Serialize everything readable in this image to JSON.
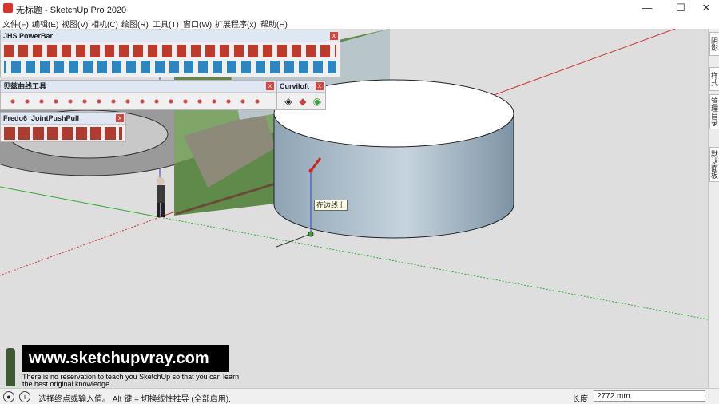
{
  "window": {
    "title": "无标题 - SketchUp Pro 2020",
    "min": "—",
    "max": "☐",
    "close": "✕"
  },
  "menu": [
    "文件(F)",
    "编辑(E)",
    "视图(V)",
    "相机(C)",
    "绘图(R)",
    "工具(T)",
    "窗口(W)",
    "扩展程序(x)",
    "帮助(H)"
  ],
  "palettes": {
    "powerbar": {
      "title": "JHS PowerBar"
    },
    "bezier": {
      "title": "贝兹曲线工具"
    },
    "curviloft": {
      "title": "Curviloft"
    },
    "fredo": {
      "title": "Fredo6_JointPushPull"
    },
    "close_label": "x"
  },
  "viewport": {
    "tooltip": "在边线上"
  },
  "watermark": {
    "url": "www.sketchupvray.com",
    "line1": "There is no reservation to teach you SketchUp so that you can learn",
    "line2": "the best original knowledge."
  },
  "statusbar": {
    "text": "选择终点或输入值。 Alt 键 = 切换线性推导 (全部启用).",
    "measure_label": "长度",
    "measure_value": "2772 mm"
  },
  "dock_tabs": [
    "阴影",
    "样式",
    "管理目录",
    "默认面板"
  ],
  "colors": {
    "red_axis": "#cc3333",
    "green_axis": "#33aa33",
    "blue_axis": "#3344cc",
    "accent": "#d9453b"
  }
}
